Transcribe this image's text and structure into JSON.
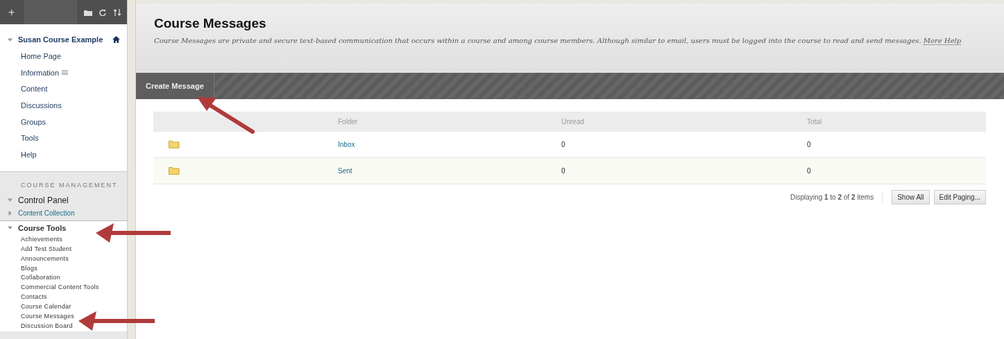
{
  "sidebar": {
    "toolbar": {
      "add": "+"
    },
    "course": {
      "title": "Susan Course Example",
      "expanded": true,
      "items": [
        {
          "label": "Home Page",
          "has_icon": false
        },
        {
          "label": "Information",
          "has_icon": true
        },
        {
          "label": "Content",
          "has_icon": false
        },
        {
          "label": "Discussions",
          "has_icon": false
        },
        {
          "label": "Groups",
          "has_icon": false
        },
        {
          "label": "Tools",
          "has_icon": false
        },
        {
          "label": "Help",
          "has_icon": false
        }
      ]
    },
    "management": {
      "heading": "COURSE MANAGEMENT",
      "sections": [
        {
          "label": "Control Panel",
          "expanded": true,
          "children": [
            {
              "label": "Content Collection",
              "expanded": false,
              "kind": "link"
            }
          ]
        },
        {
          "label": "Course Tools",
          "expanded": true,
          "children": [
            {
              "label": "Achievements"
            },
            {
              "label": "Add Test Student"
            },
            {
              "label": "Announcements"
            },
            {
              "label": "Blogs"
            },
            {
              "label": "Collaboration"
            },
            {
              "label": "Commercial Content Tools"
            },
            {
              "label": "Contacts"
            },
            {
              "label": "Course Calendar"
            },
            {
              "label": "Course Messages"
            },
            {
              "label": "Discussion Board"
            }
          ]
        }
      ]
    }
  },
  "page": {
    "title": "Course Messages",
    "description": "Course Messages are private and secure text-based communication that occurs within a course and among course members. Although similar to email, users must be logged into the course to read and send messages.",
    "help_link": "More Help"
  },
  "action_bar": {
    "buttons": [
      "Create Message"
    ]
  },
  "table": {
    "columns": [
      "Folder",
      "Unread",
      "Total"
    ],
    "rows": [
      {
        "folder": "Inbox",
        "unread": "0",
        "total": "0"
      },
      {
        "folder": "Sent",
        "unread": "0",
        "total": "0"
      }
    ]
  },
  "paging": {
    "summary": "Displaying **1** to **2** of **2** items",
    "buttons": [
      "Show All",
      "Edit Paging..."
    ]
  }
}
